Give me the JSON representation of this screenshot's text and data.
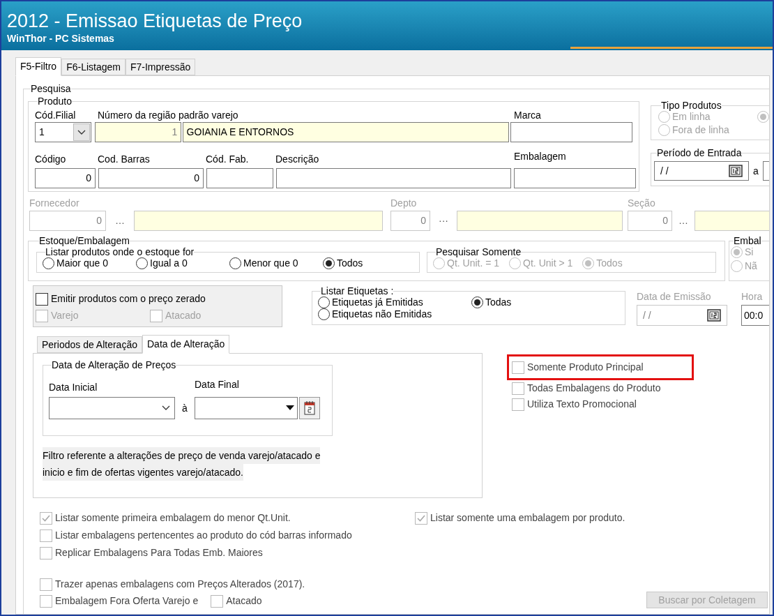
{
  "window": {
    "title": "2012 - Emissao Etiquetas de Preço",
    "subtitle": "WinThor - PC Sistemas"
  },
  "tabs": [
    {
      "label": "F5-Filtro",
      "selected": true
    },
    {
      "label": "F6-Listagem",
      "selected": false
    },
    {
      "label": "F7-Impressão",
      "selected": false
    }
  ],
  "pesquisa": {
    "title": "Pesquisa"
  },
  "produto": {
    "title": "Produto",
    "filial": {
      "label": "Cód.Filial",
      "value": "1"
    },
    "regiao": {
      "label": "Número da região padrão varejo",
      "value": "1",
      "name": "GOIANIA E ENTORNOS"
    },
    "marca": {
      "label": "Marca"
    },
    "codigo": {
      "label": "Código",
      "value": "0"
    },
    "barras": {
      "label": "Cod. Barras",
      "value": "0"
    },
    "fab": {
      "label": "Cód. Fab."
    },
    "descricao": {
      "label": "Descrição"
    },
    "embalagem": {
      "label": "Embalagem"
    }
  },
  "tipo_produtos": {
    "title": "Tipo Produtos",
    "disabled": true,
    "options": [
      {
        "label": "Em linha",
        "selected": false
      },
      {
        "label": "Fora de linha",
        "selected": false
      },
      {
        "selected": true
      }
    ]
  },
  "periodo_entrada": {
    "title": "Período de Entrada",
    "from": "/ /",
    "separator": "a"
  },
  "fornecedor": {
    "label": "Fornecedor",
    "value": "0",
    "ellipsis": "…",
    "disabled": true
  },
  "depto": {
    "label": "Depto",
    "value": "0",
    "ellipsis": "···",
    "disabled": true
  },
  "secao": {
    "label": "Seção",
    "value": "0",
    "ellipsis": "…",
    "disabled": true
  },
  "estoque": {
    "title": "Estoque/Embalagem",
    "listar": {
      "title": "Listar produtos onde o estoque for",
      "options": [
        {
          "label": "Maior que 0",
          "selected": false
        },
        {
          "label": "Igual a 0",
          "selected": false
        },
        {
          "label": "Menor que 0",
          "selected": false
        },
        {
          "label": "Todos",
          "selected": true
        }
      ]
    },
    "pesquisar": {
      "title": "Pesquisar Somente",
      "disabled": true,
      "options": [
        {
          "label": "Qt. Unit. = 1",
          "selected": false
        },
        {
          "label": "Qt. Unit  > 1",
          "selected": false
        },
        {
          "label": "Todos",
          "selected": true
        }
      ]
    }
  },
  "embal": {
    "title": "Embal",
    "disabled": true,
    "options": [
      {
        "label": "Si",
        "selected": true
      },
      {
        "label": "Nã",
        "selected": false
      }
    ]
  },
  "preco_zerado": {
    "label": "Emitir produtos com o preço zerado",
    "checked": false,
    "sub": [
      {
        "label": "Varejo",
        "checked": false,
        "disabled": true
      },
      {
        "label": "Atacado",
        "checked": false,
        "disabled": true
      }
    ]
  },
  "listar_etiquetas": {
    "title": "Listar Etiquetas :",
    "options": [
      {
        "label": "Etiquetas já Emitidas",
        "selected": false
      },
      {
        "label": "Etiquetas não Emitidas",
        "selected": false
      },
      {
        "label": "Todas",
        "selected": true
      }
    ]
  },
  "data_emissao": {
    "label": "Data de Emissão",
    "value": "/ /",
    "disabled": true
  },
  "hora": {
    "label": "Hora",
    "value": "00:0"
  },
  "sub_tabs": [
    {
      "label": "Periodos de Alteração",
      "selected": false
    },
    {
      "label": "Data de Alteração",
      "selected": true
    }
  ],
  "data_alteracao": {
    "title": "Data de Alteração de Preços",
    "inicial": {
      "label": "Data Inicial"
    },
    "separator": "à",
    "final": {
      "label": "Data Final"
    },
    "note_lines": [
      "Filtro referente a alterações de preço de venda varejo/atacado e",
      "inicio e fim de ofertas vigentes varejo/atacado."
    ]
  },
  "options_right": [
    {
      "label": "Somente Produto Principal",
      "checked": false,
      "highlighted": true
    },
    {
      "label": "Todas Embalagens do Produto",
      "checked": false,
      "highlighted": false
    },
    {
      "label": "Utiliza Texto Promocional",
      "checked": false,
      "highlighted": false
    }
  ],
  "bottom_left": [
    {
      "label": "Listar somente primeira embalagem do menor Qt.Unit.",
      "checked": true
    },
    {
      "label": "Listar embalagens pertencentes ao produto do cód barras informado",
      "checked": false
    },
    {
      "label": "Replicar Embalagens Para Todas Emb. Maiores",
      "checked": false
    }
  ],
  "bottom_right": [
    {
      "label": "Listar somente uma embalagem por produto.",
      "checked": true
    }
  ],
  "trazer": {
    "label": "Trazer apenas embalagens com Preços Alterados (2017).",
    "checked": false
  },
  "fora_oferta": [
    {
      "label": "Embalagem Fora Oferta Varejo e",
      "checked": false
    },
    {
      "label": "Atacado",
      "checked": false
    }
  ],
  "buscar_button": {
    "label": "Buscar por Coletagem",
    "disabled": true
  }
}
